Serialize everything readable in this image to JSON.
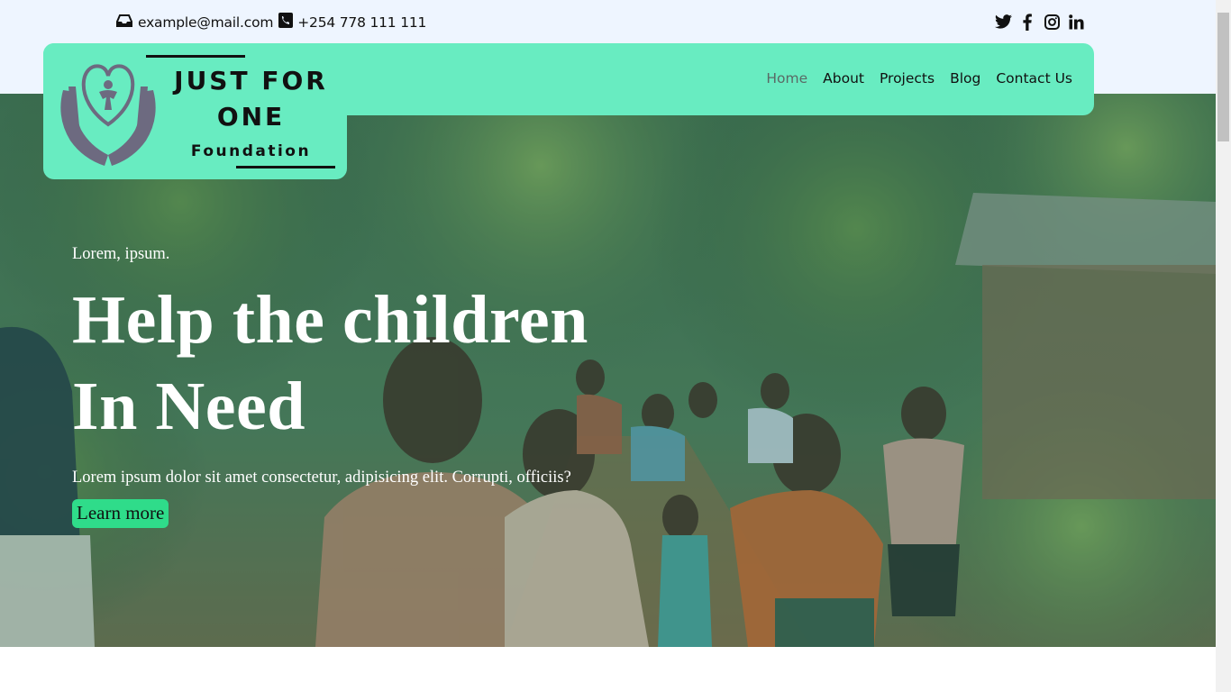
{
  "topbar": {
    "email": "example@mail.com",
    "phone": "+254 778 111 111",
    "social_icons": [
      "twitter-icon",
      "facebook-icon",
      "instagram-icon",
      "linkedin-icon"
    ]
  },
  "logo": {
    "line1": "JUST FOR",
    "line2": "ONE",
    "line3": "Foundation"
  },
  "nav": {
    "items": [
      "Home",
      "About",
      "Projects",
      "Blog",
      "Contact Us"
    ],
    "active": "Home"
  },
  "hero": {
    "eyebrow": "Lorem, ipsum.",
    "headline_line1": "Help the children",
    "headline_line2": "In Need",
    "subtitle": "Lorem ipsum dolor sit amet consectetur, adipisicing elit. Corrupti, officiis?",
    "cta_label": "Learn more"
  },
  "colors": {
    "brand_green": "#68ecc1",
    "cta_green": "#2fdc8a",
    "topbar_bg": "#eef5ff"
  }
}
